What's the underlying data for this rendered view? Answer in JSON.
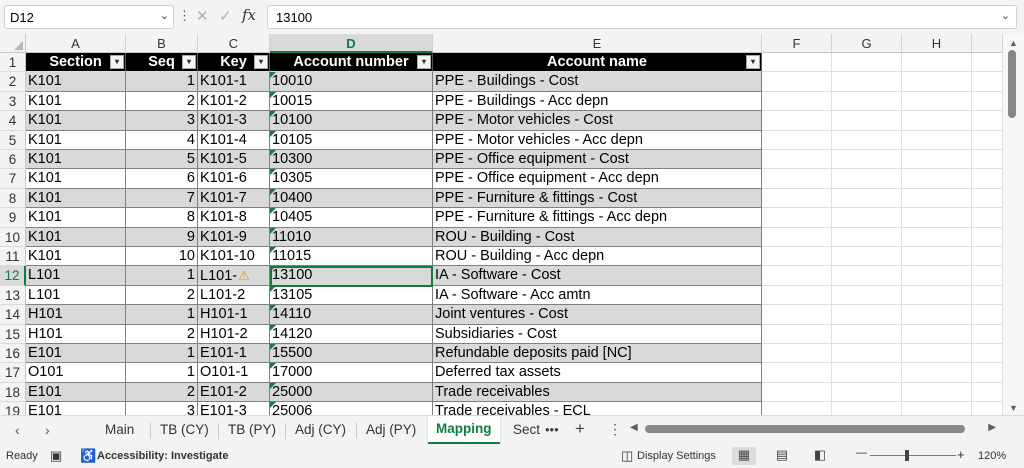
{
  "formula_bar": {
    "name_box": "D12",
    "formula": "13100",
    "fx_label": "fx",
    "dropdown_icon": "chevron-down-icon"
  },
  "columns": [
    "A",
    "B",
    "C",
    "D",
    "E",
    "F",
    "G",
    "H"
  ],
  "selected_column": "D",
  "selected_row": 12,
  "table": {
    "headers": [
      "Section",
      "Seq",
      "Key",
      "Account number",
      "Account name"
    ],
    "rows": [
      {
        "row": "2",
        "section": "K101",
        "seq": "1",
        "key": "K101-1",
        "account_number": "10010",
        "account_name": "PPE - Buildings - Cost"
      },
      {
        "row": "3",
        "section": "K101",
        "seq": "2",
        "key": "K101-2",
        "account_number": "10015",
        "account_name": "PPE - Buildings - Acc depn"
      },
      {
        "row": "4",
        "section": "K101",
        "seq": "3",
        "key": "K101-3",
        "account_number": "10100",
        "account_name": "PPE - Motor vehicles - Cost"
      },
      {
        "row": "5",
        "section": "K101",
        "seq": "4",
        "key": "K101-4",
        "account_number": "10105",
        "account_name": "PPE - Motor vehicles - Acc depn"
      },
      {
        "row": "6",
        "section": "K101",
        "seq": "5",
        "key": "K101-5",
        "account_number": "10300",
        "account_name": "PPE - Office equipment - Cost"
      },
      {
        "row": "7",
        "section": "K101",
        "seq": "6",
        "key": "K101-6",
        "account_number": "10305",
        "account_name": "PPE - Office equipment - Acc depn"
      },
      {
        "row": "8",
        "section": "K101",
        "seq": "7",
        "key": "K101-7",
        "account_number": "10400",
        "account_name": "PPE - Furniture & fittings - Cost"
      },
      {
        "row": "9",
        "section": "K101",
        "seq": "8",
        "key": "K101-8",
        "account_number": "10405",
        "account_name": "PPE - Furniture & fittings - Acc depn"
      },
      {
        "row": "10",
        "section": "K101",
        "seq": "9",
        "key": "K101-9",
        "account_number": "11010",
        "account_name": "ROU - Building - Cost"
      },
      {
        "row": "11",
        "section": "K101",
        "seq": "10",
        "key": "K101-10",
        "account_number": "11015",
        "account_name": "ROU - Building - Acc depn"
      },
      {
        "row": "12",
        "section": "L101",
        "seq": "1",
        "key": "L101-",
        "account_number": "13100",
        "account_name": "IA - Software - Cost"
      },
      {
        "row": "13",
        "section": "L101",
        "seq": "2",
        "key": "L101-2",
        "account_number": "13105",
        "account_name": "IA - Software - Acc amtn"
      },
      {
        "row": "14",
        "section": "H101",
        "seq": "1",
        "key": "H101-1",
        "account_number": "14110",
        "account_name": "Joint ventures - Cost"
      },
      {
        "row": "15",
        "section": "H101",
        "seq": "2",
        "key": "H101-2",
        "account_number": "14120",
        "account_name": "Subsidiaries - Cost"
      },
      {
        "row": "16",
        "section": "E101",
        "seq": "1",
        "key": "E101-1",
        "account_number": "15500",
        "account_name": "Refundable deposits paid [NC]"
      },
      {
        "row": "17",
        "section": "O101",
        "seq": "1",
        "key": "O101-1",
        "account_number": "17000",
        "account_name": "Deferred tax assets"
      },
      {
        "row": "18",
        "section": "E101",
        "seq": "2",
        "key": "E101-2",
        "account_number": "25000",
        "account_name": "Trade receivables"
      },
      {
        "row": "19",
        "section": "E101",
        "seq": "3",
        "key": "E101-3",
        "account_number": "25006",
        "account_name": "Trade receivables - ECL"
      }
    ],
    "header_row_number": "1"
  },
  "sheet_tabs": {
    "tabs": [
      "Main",
      "TB (CY)",
      "TB (PY)",
      "Adj (CY)",
      "Adj (PY)",
      "Mapping",
      "Sect"
    ],
    "active": "Mapping",
    "more": "•••",
    "add": "+",
    "nav_prev": "‹",
    "nav_next": "›"
  },
  "status_bar": {
    "ready": "Ready",
    "accessibility": "Accessibility: Investigate",
    "display_settings": "Display Settings",
    "zoom": "120%",
    "zoom_out": "—",
    "zoom_in": "+"
  },
  "colors": {
    "accent": "#107c41",
    "band": "#d9d9d9",
    "header_bg": "#000000",
    "warning": "#e69b00"
  }
}
